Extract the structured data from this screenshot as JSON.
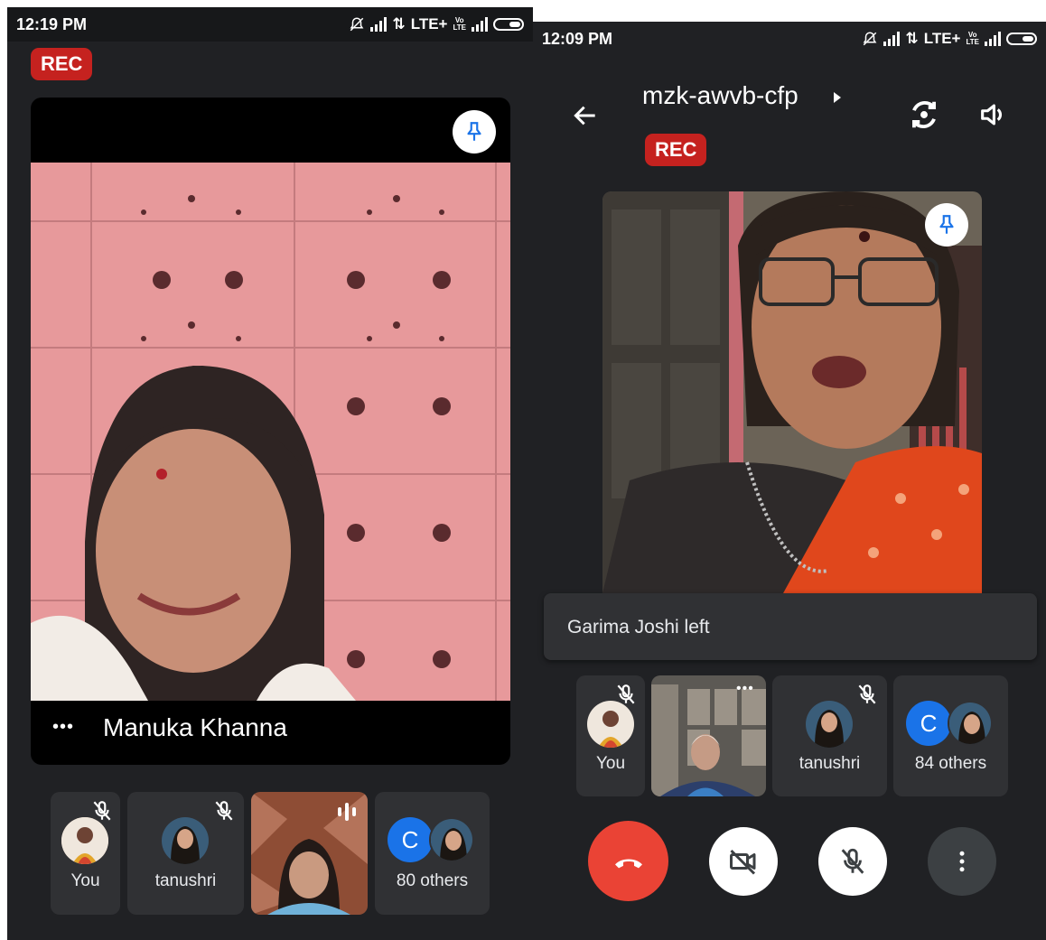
{
  "left": {
    "status": {
      "time": "12:19 PM",
      "network": "LTE+",
      "volte": "Vo\nLTE"
    },
    "rec_label": "REC",
    "main_tile": {
      "name": "Manuka Khanna",
      "more_glyph": "•••"
    },
    "participants": [
      {
        "label": "You"
      },
      {
        "label": "tanushri"
      },
      {
        "label": ""
      },
      {
        "label": "80 others",
        "avatar_letter": "C"
      }
    ]
  },
  "right": {
    "status": {
      "time": "12:09 PM",
      "network": "LTE+",
      "volte": "Vo\nLTE"
    },
    "meeting_code": "mzk-awvb-cfp",
    "rec_label": "REC",
    "toast": "Garima Joshi left",
    "participants": [
      {
        "label": "You"
      },
      {
        "label": ""
      },
      {
        "label": "tanushri"
      },
      {
        "label": "84 others",
        "avatar_letter": "C"
      }
    ]
  },
  "colors": {
    "accent_red": "#c5221f",
    "end_call": "#ea4335",
    "pin_blue": "#1a73e8",
    "avatar_c": "#1a73e8"
  }
}
